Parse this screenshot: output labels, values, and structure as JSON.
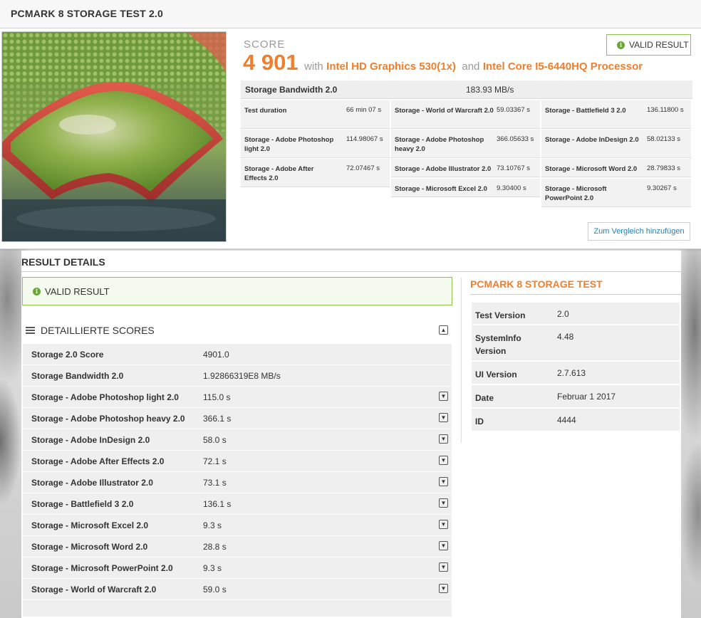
{
  "header": {
    "title": "PCMARK 8 STORAGE TEST 2.0"
  },
  "summary": {
    "score_label": "SCORE",
    "score_value": "4 901",
    "with_text": "with",
    "gpu": "Intel HD Graphics 530(1x)",
    "and_text": "and",
    "cpu": "Intel Core I5-6440HQ Processor",
    "valid_label": "VALID RESULT",
    "bandwidth_label": "Storage Bandwidth 2.0",
    "bandwidth_value": "183.93 MB/s",
    "cells": [
      {
        "label": "Test duration",
        "value": "66 min 07 s"
      },
      {
        "label": "Storage - World of Warcraft 2.0",
        "value": "59.03367 s"
      },
      {
        "label": "Storage - Battlefield 3 2.0",
        "value": "136.11800 s"
      },
      {
        "label": "Storage - Adobe Photoshop light 2.0",
        "value": "114.98067 s"
      },
      {
        "label": "Storage - Adobe Photoshop heavy 2.0",
        "value": "366.05633 s"
      },
      {
        "label": "Storage - Adobe InDesign 2.0",
        "value": "58.02133 s"
      },
      {
        "label": "Storage - Adobe After Effects 2.0",
        "value": "72.07467 s"
      },
      {
        "label": "Storage - Adobe Illustrator 2.0",
        "value": "73.10767 s"
      },
      {
        "label": "Storage - Microsoft Word 2.0",
        "value": "28.79833 s"
      },
      {
        "label": "Storage - Microsoft Excel 2.0",
        "value": "9.30400 s"
      },
      {
        "label": "Storage - Microsoft PowerPoint 2.0",
        "value": "9.30267 s"
      }
    ],
    "compare_button": "Zum Vergleich hinzufügen"
  },
  "details": {
    "title": "RESULT DETAILS",
    "valid_label": "VALID RESULT",
    "scores_title": "DETAILLIERTE SCORES",
    "rows": [
      {
        "label": "Storage 2.0 Score",
        "value": "4901.0"
      },
      {
        "label": "Storage Bandwidth 2.0",
        "value": "1.92866319E8 MB/s"
      },
      {
        "label": "Storage - Adobe Photoshop light 2.0",
        "value": "115.0 s"
      },
      {
        "label": "Storage - Adobe Photoshop heavy 2.0",
        "value": "366.1 s"
      },
      {
        "label": "Storage - Adobe InDesign 2.0",
        "value": "58.0 s"
      },
      {
        "label": "Storage - Adobe After Effects 2.0",
        "value": "72.1 s"
      },
      {
        "label": "Storage - Adobe Illustrator 2.0",
        "value": "73.1 s"
      },
      {
        "label": "Storage - Battlefield 3 2.0",
        "value": "136.1 s"
      },
      {
        "label": "Storage - Microsoft Excel 2.0",
        "value": "9.3 s"
      },
      {
        "label": "Storage - Microsoft Word 2.0",
        "value": "28.8 s"
      },
      {
        "label": "Storage - Microsoft PowerPoint 2.0",
        "value": "9.3 s"
      },
      {
        "label": "Storage - World of Warcraft 2.0",
        "value": "59.0 s"
      }
    ]
  },
  "test_info": {
    "title": "PCMARK 8 STORAGE TEST",
    "rows": [
      {
        "label": "Test Version",
        "value": "2.0"
      },
      {
        "label": "SystemInfo Version",
        "value": "4.48"
      },
      {
        "label": "UI Version",
        "value": "2.7.613"
      },
      {
        "label": "Date",
        "value": "Februar 1 2017"
      },
      {
        "label": "ID",
        "value": "4444"
      }
    ]
  },
  "colors": {
    "accent": "#f07e2b",
    "valid_green": "#8bc34a",
    "link": "#2a7fb0"
  }
}
